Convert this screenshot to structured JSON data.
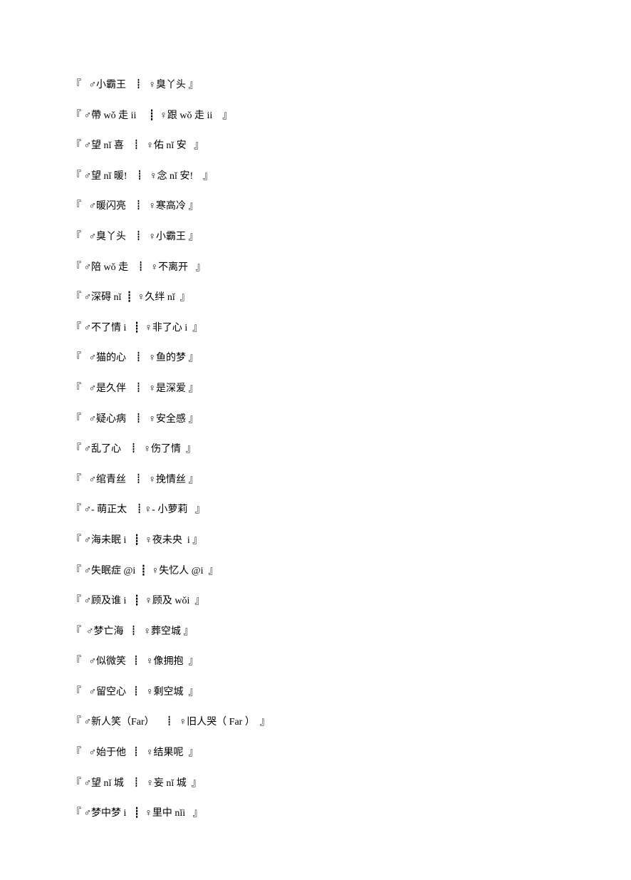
{
  "pairs": [
    {
      "left": "♂小霸王",
      "right": "♀臭丫头",
      "lpad": "   ",
      "mpad": "   ┋  ",
      "rpad": " "
    },
    {
      "left": "♂帶 wǒ 走 ii",
      "right": "♀跟 wǒ 走 ii",
      "lpad": " ",
      "mpad": "     ┋  ",
      "rpad": "    "
    },
    {
      "left": "♂望 nǐ 喜",
      "right": "♀佑 nǐ 安",
      "lpad": " ",
      "mpad": "   ┋  ",
      "rpad": "   "
    },
    {
      "left": "♂望 nǐ 暖!",
      "right": "♀念 nǐ 安!",
      "lpad": " ",
      "mpad": "   ┋  ",
      "rpad": "    "
    },
    {
      "left": "♂暖闪亮",
      "right": "♀寒高冷",
      "lpad": "   ",
      "mpad": "   ┋  ",
      "rpad": " "
    },
    {
      "left": "♂臭丫头",
      "right": "♀小霸王",
      "lpad": "   ",
      "mpad": "   ┋  ",
      "rpad": " "
    },
    {
      "left": "♂陪 wǒ 走",
      "right": "♀不离开",
      "lpad": " ",
      "mpad": "   ┋  ",
      "rpad": "   "
    },
    {
      "left": "♂深碍 nǐ",
      "right": "♀久绊 nǐ",
      "lpad": " ",
      "mpad": "  ┋  ",
      "rpad": "  "
    },
    {
      "left": "♂不了情 i",
      "right": "♀非了心 i",
      "lpad": " ",
      "mpad": "   ┋  ",
      "rpad": "  "
    },
    {
      "left": "♂猫的心",
      "right": "♀鱼的梦",
      "lpad": "   ",
      "mpad": "   ┋  ",
      "rpad": " "
    },
    {
      "left": "♂是久伴",
      "right": "♀是深爱",
      "lpad": "   ",
      "mpad": "   ┋  ",
      "rpad": " "
    },
    {
      "left": "♂疑心病",
      "right": "♀安全感",
      "lpad": "   ",
      "mpad": "   ┋  ",
      "rpad": " "
    },
    {
      "left": "♂乱了心",
      "right": "♀伤了情",
      "lpad": " ",
      "mpad": "   ┋  ",
      "rpad": "  "
    },
    {
      "left": "♂绾青丝",
      "right": "♀挽情丝",
      "lpad": "   ",
      "mpad": "   ┋  ",
      "rpad": " "
    },
    {
      "left": "♂- 萌正太",
      "right": "♀- 小萝莉",
      "lpad": " ",
      "mpad": "   ┋",
      "rpad": "   "
    },
    {
      "left": "♂海未眠 i",
      "right": "♀夜未央  i",
      "lpad": " ",
      "mpad": "   ┋  ",
      "rpad": " "
    },
    {
      "left": "♂失眠症 @i",
      "right": "♀失忆人 @i",
      "lpad": " ",
      "mpad": "  ┋  ",
      "rpad": "  "
    },
    {
      "left": "♂顾及谁 i",
      "right": "♀顾及 wǒi",
      "lpad": " ",
      "mpad": "   ┋  ",
      "rpad": "  "
    },
    {
      "left": "♂梦亡海",
      "right": "♀葬空城",
      "lpad": "  ",
      "mpad": "  ┋  ",
      "rpad": " "
    },
    {
      "left": "♂似微笑",
      "right": "♀像拥抱",
      "lpad": "   ",
      "mpad": "  ┋  ",
      "rpad": "  "
    },
    {
      "left": "♂留空心",
      "right": "♀剩空城",
      "lpad": "   ",
      "mpad": "  ┋  ",
      "rpad": "  "
    },
    {
      "left": "♂新人笑（Far）",
      "right": "♀旧人哭（ Far ）",
      "lpad": " ",
      "mpad": "    ┋  ",
      "rpad": "  "
    },
    {
      "left": "♂始于他",
      "right": "♀结果呢",
      "lpad": "   ",
      "mpad": "  ┋  ",
      "rpad": "  "
    },
    {
      "left": "♂望 nǐ 城",
      "right": "♀妄 nǐ 城",
      "lpad": " ",
      "mpad": "   ┋  ",
      "rpad": "  "
    },
    {
      "left": "♂梦中梦 i",
      "right": "♀里中 nǐi",
      "lpad": " ",
      "mpad": "   ┋  ",
      "rpad": "   "
    }
  ],
  "brackets": {
    "open": "『",
    "close": "』"
  }
}
